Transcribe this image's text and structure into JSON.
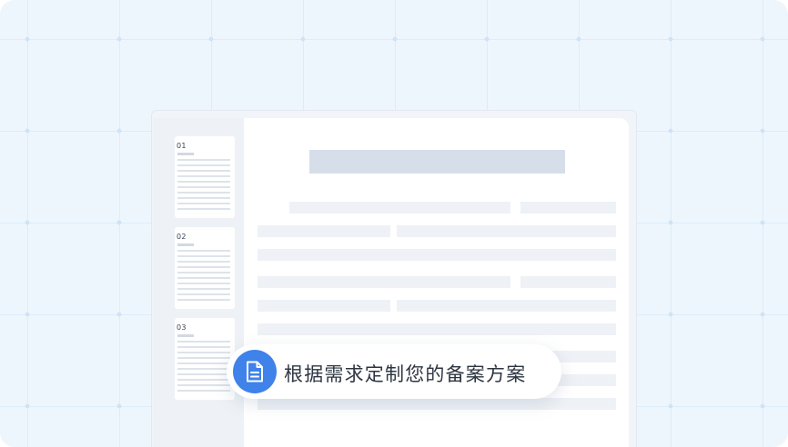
{
  "thumbnails": [
    {
      "number": "01"
    },
    {
      "number": "02"
    },
    {
      "number": "03"
    }
  ],
  "callout": {
    "icon": "document-icon",
    "text": "根据需求定制您的备案方案"
  },
  "colors": {
    "background": "#eef6fd",
    "accent": "#3e82ea",
    "placeholder": "#eef1f5",
    "title_placeholder": "#d6deea"
  }
}
